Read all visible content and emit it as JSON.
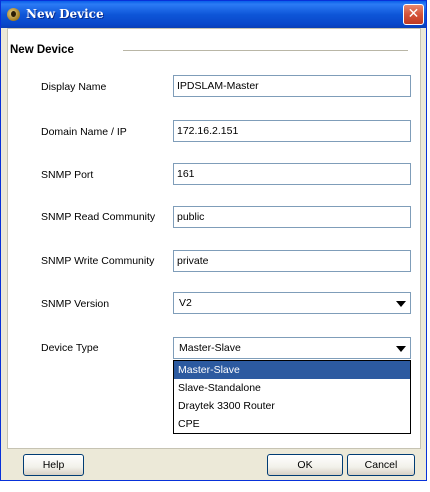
{
  "window": {
    "title": "New Device",
    "close_glyph": "✕"
  },
  "panel": {
    "legend": "New Device"
  },
  "form": {
    "display_name": {
      "label": "Display Name",
      "value": "IPDSLAM-Master"
    },
    "domain": {
      "label": "Domain Name / IP",
      "value": "172.16.2.151"
    },
    "snmp_port": {
      "label": "SNMP Port",
      "value": "161"
    },
    "read_community": {
      "label": "SNMP Read Community",
      "value": "public"
    },
    "write_community": {
      "label": "SNMP Write Community",
      "value": "private"
    },
    "snmp_version": {
      "label": "SNMP Version",
      "value": "V2"
    },
    "device_type": {
      "label": "Device Type",
      "value": "Master-Slave",
      "options": [
        "Master-Slave",
        "Slave-Standalone",
        "Draytek 3300 Router",
        "CPE"
      ]
    }
  },
  "buttons": {
    "help": "Help",
    "ok": "OK",
    "cancel": "Cancel"
  },
  "colors": {
    "title_bar": "#0a56d8",
    "selection": "#2c5aa0",
    "close_button": "#d4533a"
  },
  "icons": {
    "title": "app-logo-icon",
    "close": "close-icon",
    "dropdown": "chevron-down-icon"
  }
}
